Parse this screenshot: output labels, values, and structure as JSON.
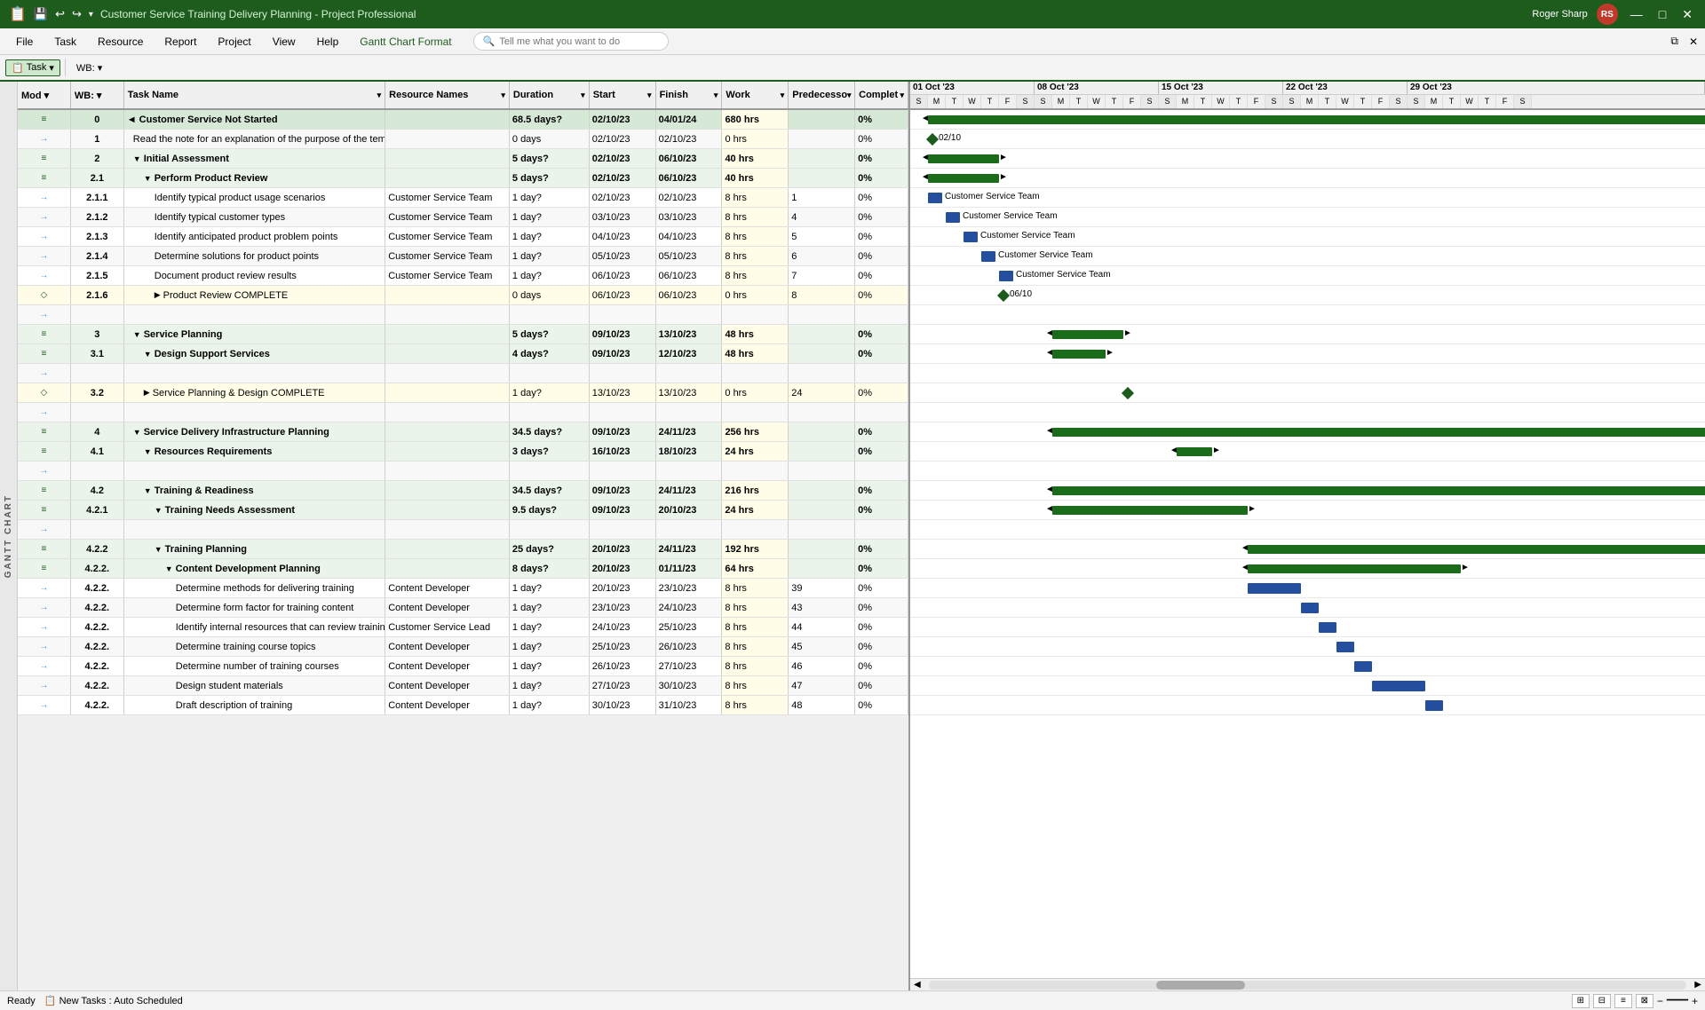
{
  "titlebar": {
    "app_icon": "📋",
    "title": "Customer Service Training Delivery Planning  -  Project Professional",
    "user_name": "Roger Sharp",
    "user_initials": "RS",
    "minimize": "—",
    "maximize": "□",
    "close": "✕"
  },
  "menubar": {
    "items": [
      "File",
      "Task",
      "Resource",
      "Report",
      "Project",
      "View",
      "Help",
      "Gantt Chart Format"
    ],
    "search_placeholder": "Tell me what you want to do"
  },
  "toolbar": {
    "task_mode": "Task",
    "wb_label": "WB: ▾",
    "mode_label": "Mod ▾"
  },
  "columns": {
    "mode": "Mod",
    "wb": "WB:",
    "taskname": "Task Name",
    "resnames": "Resource Names",
    "duration": "Duration",
    "start": "Start",
    "finish": "Finish",
    "work": "Work",
    "pred": "Predecesso",
    "complete": "Complet"
  },
  "rows": [
    {
      "id": 0,
      "wb": "0",
      "taskname": "Customer Service Not Started",
      "resnames": "",
      "duration": "68.5 days?",
      "start": "02/10/23",
      "finish": "04/01/24",
      "work": "680 hrs",
      "pred": "",
      "complete": "0%",
      "indent": 0,
      "type": "summary0",
      "collapsed": false
    },
    {
      "id": 1,
      "wb": "1",
      "taskname": "Read the note for an explanation of the purpose of the template",
      "resnames": "",
      "duration": "0 days",
      "start": "02/10/23",
      "finish": "02/10/23",
      "work": "0 hrs",
      "pred": "",
      "complete": "0%",
      "indent": 1,
      "type": "normal"
    },
    {
      "id": 2,
      "wb": "2",
      "taskname": "Initial Assessment",
      "resnames": "",
      "duration": "5 days?",
      "start": "02/10/23",
      "finish": "06/10/23",
      "work": "40 hrs",
      "pred": "",
      "complete": "0%",
      "indent": 1,
      "type": "summary"
    },
    {
      "id": 3,
      "wb": "2.1",
      "taskname": "Perform Product Review",
      "resnames": "",
      "duration": "5 days?",
      "start": "02/10/23",
      "finish": "06/10/23",
      "work": "40 hrs",
      "pred": "",
      "complete": "0%",
      "indent": 2,
      "type": "summary"
    },
    {
      "id": 4,
      "wb": "2.1.1",
      "taskname": "Identify typical product usage scenarios",
      "resnames": "Customer Service Team",
      "duration": "1 day?",
      "start": "02/10/23",
      "finish": "02/10/23",
      "work": "8 hrs",
      "pred": "1",
      "complete": "0%",
      "indent": 3,
      "type": "normal"
    },
    {
      "id": 5,
      "wb": "2.1.2",
      "taskname": "Identify typical customer types",
      "resnames": "Customer Service Team",
      "duration": "1 day?",
      "start": "03/10/23",
      "finish": "03/10/23",
      "work": "8 hrs",
      "pred": "4",
      "complete": "0%",
      "indent": 3,
      "type": "normal"
    },
    {
      "id": 6,
      "wb": "2.1.3",
      "taskname": "Identify anticipated product problem points",
      "resnames": "Customer Service Team",
      "duration": "1 day?",
      "start": "04/10/23",
      "finish": "04/10/23",
      "work": "8 hrs",
      "pred": "5",
      "complete": "0%",
      "indent": 3,
      "type": "normal"
    },
    {
      "id": 7,
      "wb": "2.1.4",
      "taskname": "Determine solutions for product points",
      "resnames": "Customer Service Team",
      "duration": "1 day?",
      "start": "05/10/23",
      "finish": "05/10/23",
      "work": "8 hrs",
      "pred": "6",
      "complete": "0%",
      "indent": 3,
      "type": "normal"
    },
    {
      "id": 8,
      "wb": "2.1.5",
      "taskname": "Document product review results",
      "resnames": "Customer Service Team",
      "duration": "1 day?",
      "start": "06/10/23",
      "finish": "06/10/23",
      "work": "8 hrs",
      "pred": "7",
      "complete": "0%",
      "indent": 3,
      "type": "normal"
    },
    {
      "id": 9,
      "wb": "2.1.6",
      "taskname": "Product Review COMPLETE",
      "resnames": "",
      "duration": "0 days",
      "start": "06/10/23",
      "finish": "06/10/23",
      "work": "0 hrs",
      "pred": "8",
      "complete": "0%",
      "indent": 3,
      "type": "milestone"
    },
    {
      "id": 10,
      "wb": "",
      "taskname": "",
      "resnames": "",
      "duration": "",
      "start": "",
      "finish": "",
      "work": "",
      "pred": "",
      "complete": "",
      "indent": 0,
      "type": "empty"
    },
    {
      "id": 11,
      "wb": "3",
      "taskname": "Service Planning",
      "resnames": "",
      "duration": "5 days?",
      "start": "09/10/23",
      "finish": "13/10/23",
      "work": "48 hrs",
      "pred": "",
      "complete": "0%",
      "indent": 1,
      "type": "summary"
    },
    {
      "id": 12,
      "wb": "3.1",
      "taskname": "Design Support Services",
      "resnames": "",
      "duration": "4 days?",
      "start": "09/10/23",
      "finish": "12/10/23",
      "work": "48 hrs",
      "pred": "",
      "complete": "0%",
      "indent": 2,
      "type": "summary"
    },
    {
      "id": 18,
      "wb": "",
      "taskname": "",
      "resnames": "",
      "duration": "",
      "start": "",
      "finish": "",
      "work": "",
      "pred": "",
      "complete": "",
      "indent": 0,
      "type": "empty"
    },
    {
      "id": 25,
      "wb": "3.2",
      "taskname": "Service Planning & Design COMPLETE",
      "resnames": "",
      "duration": "1 day?",
      "start": "13/10/23",
      "finish": "13/10/23",
      "work": "0 hrs",
      "pred": "24",
      "complete": "0%",
      "indent": 2,
      "type": "milestone"
    },
    {
      "id": 26,
      "wb": "",
      "taskname": "",
      "resnames": "",
      "duration": "",
      "start": "",
      "finish": "",
      "work": "",
      "pred": "",
      "complete": "",
      "indent": 0,
      "type": "empty"
    },
    {
      "id": 27,
      "wb": "4",
      "taskname": "Service Delivery Infrastructure Planning",
      "resnames": "",
      "duration": "34.5 days?",
      "start": "09/10/23",
      "finish": "24/11/23",
      "work": "256 hrs",
      "pred": "",
      "complete": "0%",
      "indent": 1,
      "type": "summary"
    },
    {
      "id": 28,
      "wb": "4.1",
      "taskname": "Resources Requirements",
      "resnames": "",
      "duration": "3 days?",
      "start": "16/10/23",
      "finish": "18/10/23",
      "work": "24 hrs",
      "pred": "",
      "complete": "0%",
      "indent": 2,
      "type": "summary"
    },
    {
      "id": 33,
      "wb": "",
      "taskname": "",
      "resnames": "",
      "duration": "",
      "start": "",
      "finish": "",
      "work": "",
      "pred": "",
      "complete": "",
      "indent": 0,
      "type": "empty"
    },
    {
      "id": 34,
      "wb": "4.2",
      "taskname": "Training & Readiness",
      "resnames": "",
      "duration": "34.5 days?",
      "start": "09/10/23",
      "finish": "24/11/23",
      "work": "216 hrs",
      "pred": "",
      "complete": "0%",
      "indent": 2,
      "type": "summary"
    },
    {
      "id": 35,
      "wb": "4.2.1",
      "taskname": "Training Needs Assessment",
      "resnames": "",
      "duration": "9.5 days?",
      "start": "09/10/23",
      "finish": "20/10/23",
      "work": "24 hrs",
      "pred": "",
      "complete": "0%",
      "indent": 3,
      "type": "summary"
    },
    {
      "id": 40,
      "wb": "",
      "taskname": "",
      "resnames": "",
      "duration": "",
      "start": "",
      "finish": "",
      "work": "",
      "pred": "",
      "complete": "",
      "indent": 0,
      "type": "empty"
    },
    {
      "id": 41,
      "wb": "4.2.2",
      "taskname": "Training Planning",
      "resnames": "",
      "duration": "25 days?",
      "start": "20/10/23",
      "finish": "24/11/23",
      "work": "192 hrs",
      "pred": "",
      "complete": "0%",
      "indent": 3,
      "type": "summary"
    },
    {
      "id": 42,
      "wb": "4.2.2.",
      "taskname": "Content Development Planning",
      "resnames": "",
      "duration": "8 days?",
      "start": "20/10/23",
      "finish": "01/11/23",
      "work": "64 hrs",
      "pred": "",
      "complete": "0%",
      "indent": 4,
      "type": "summary"
    },
    {
      "id": 43,
      "wb": "4.2.2.",
      "taskname": "Determine methods for delivering training",
      "resnames": "Content Developer",
      "duration": "1 day?",
      "start": "20/10/23",
      "finish": "23/10/23",
      "work": "8 hrs",
      "pred": "39",
      "complete": "0%",
      "indent": 5,
      "type": "normal"
    },
    {
      "id": 44,
      "wb": "4.2.2.",
      "taskname": "Determine form factor for training content",
      "resnames": "Content Developer",
      "duration": "1 day?",
      "start": "23/10/23",
      "finish": "24/10/23",
      "work": "8 hrs",
      "pred": "43",
      "complete": "0%",
      "indent": 5,
      "type": "normal"
    },
    {
      "id": 45,
      "wb": "4.2.2.",
      "taskname": "Identify internal resources that can review training materials",
      "resnames": "Customer Service Lead",
      "duration": "1 day?",
      "start": "24/10/23",
      "finish": "25/10/23",
      "work": "8 hrs",
      "pred": "44",
      "complete": "0%",
      "indent": 5,
      "type": "normal"
    },
    {
      "id": 46,
      "wb": "4.2.2.",
      "taskname": "Determine training course topics",
      "resnames": "Content Developer",
      "duration": "1 day?",
      "start": "25/10/23",
      "finish": "26/10/23",
      "work": "8 hrs",
      "pred": "45",
      "complete": "0%",
      "indent": 5,
      "type": "normal"
    },
    {
      "id": 47,
      "wb": "4.2.2.",
      "taskname": "Determine number of training courses",
      "resnames": "Content Developer",
      "duration": "1 day?",
      "start": "26/10/23",
      "finish": "27/10/23",
      "work": "8 hrs",
      "pred": "46",
      "complete": "0%",
      "indent": 5,
      "type": "normal"
    },
    {
      "id": 48,
      "wb": "4.2.2.",
      "taskname": "Design student materials",
      "resnames": "Content Developer",
      "duration": "1 day?",
      "start": "27/10/23",
      "finish": "30/10/23",
      "work": "8 hrs",
      "pred": "47",
      "complete": "0%",
      "indent": 5,
      "type": "normal"
    },
    {
      "id": 49,
      "wb": "4.2.2.",
      "taskname": "Draft description of training",
      "resnames": "Content Developer",
      "duration": "1 day?",
      "start": "30/10/23",
      "finish": "31/10/23",
      "work": "8 hrs",
      "pred": "48",
      "complete": "0%",
      "indent": 5,
      "type": "normal"
    }
  ],
  "gantt": {
    "weeks": [
      {
        "label": "01 Oct '23",
        "days": [
          "S",
          "M",
          "T",
          "W",
          "T",
          "F",
          "S"
        ]
      },
      {
        "label": "08 Oct '23",
        "days": [
          "S",
          "M",
          "T",
          "W",
          "T",
          "F",
          "S"
        ]
      },
      {
        "label": "15 Oct '23",
        "days": [
          "S",
          "M",
          "T",
          "W",
          "T",
          "F",
          "S"
        ]
      }
    ]
  },
  "statusbar": {
    "ready": "Ready",
    "new_tasks": "New Tasks : Auto Scheduled"
  }
}
